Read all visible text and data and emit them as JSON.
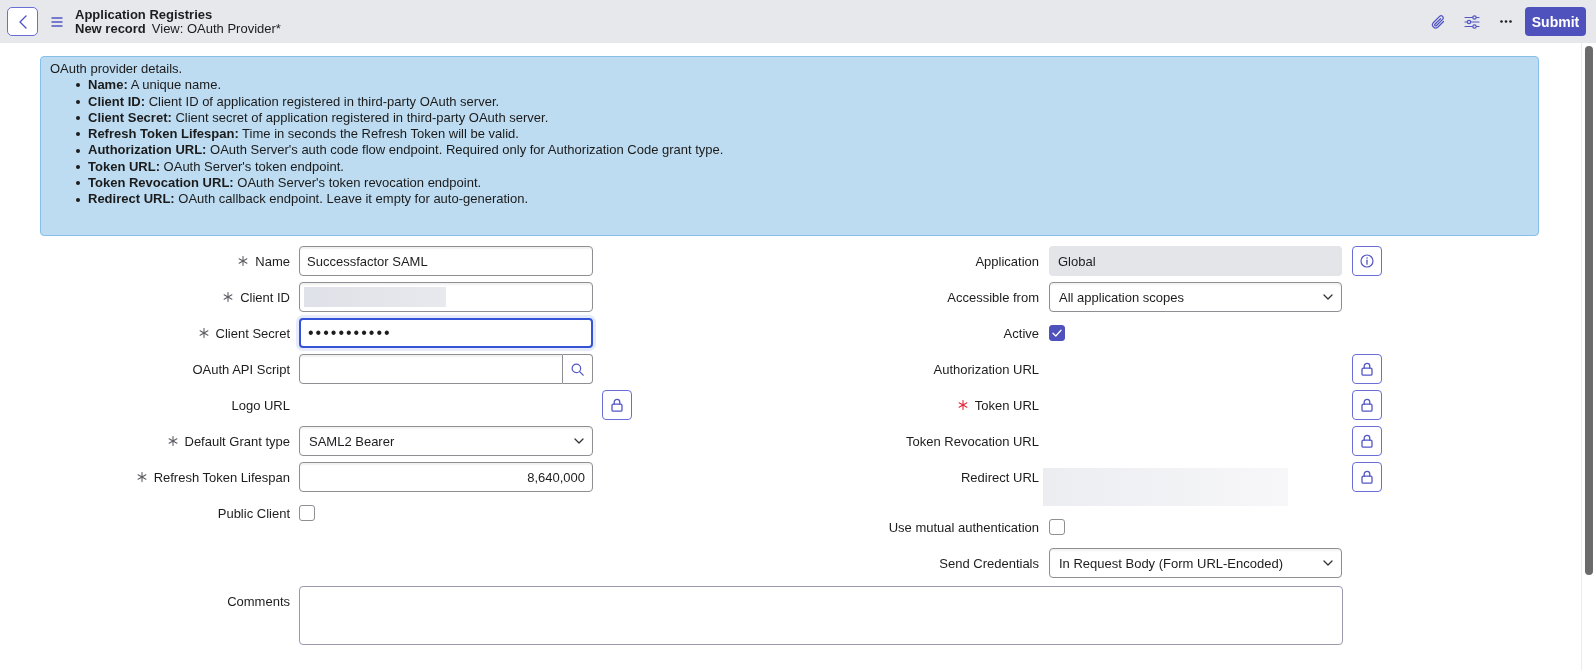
{
  "header": {
    "title": "Application Registries",
    "record_state": "New record",
    "view": "View: OAuth Provider*",
    "submit": "Submit"
  },
  "info": {
    "intro": "OAuth provider details.",
    "items": [
      "**Name:** A unique name.",
      "**Client ID:** Client ID of application registered in third-party OAuth server.",
      "**Client Secret:** Client secret of application registered in third-party OAuth server.",
      "**Refresh Token Lifespan:** Time in seconds the Refresh Token will be valid.",
      "**Authorization URL:** OAuth Server's auth code flow endpoint. Required only for Authorization Code grant type.",
      "**Token URL:** OAuth Server's token endpoint.",
      "**Token Revocation URL:** OAuth Server's token revocation endpoint.",
      "**Redirect URL:** OAuth callback endpoint. Leave it empty for auto-generation."
    ]
  },
  "form": {
    "left": [
      {
        "kind": "text",
        "label": "Name",
        "mandatory": true,
        "mandatory_met": true,
        "focused": false,
        "value": "Successfactor SAML"
      },
      {
        "kind": "text",
        "label": "Client ID",
        "mandatory": true,
        "mandatory_met": true,
        "focused": false,
        "redacted": true
      },
      {
        "kind": "password",
        "label": "Client Secret",
        "mandatory": true,
        "mandatory_met": true,
        "focused": true,
        "value": "•••••••••••"
      },
      {
        "kind": "reference",
        "label": "OAuth API Script",
        "mandatory": false,
        "focused": false
      },
      {
        "kind": "locked",
        "label": "Logo URL",
        "mandatory": false
      },
      {
        "kind": "select",
        "label": "Default Grant type",
        "mandatory": true,
        "mandatory_met": true,
        "focused": false,
        "value": "SAML2 Bearer"
      },
      {
        "kind": "number",
        "label": "Refresh Token Lifespan",
        "mandatory": true,
        "mandatory_met": true,
        "focused": false,
        "value": "8,640,000"
      },
      {
        "kind": "checkbox",
        "label": "Public Client",
        "mandatory": false,
        "checked": false
      }
    ],
    "right": [
      {
        "kind": "readonly",
        "label": "Application",
        "mandatory": false,
        "focused": false,
        "value": "Global"
      },
      {
        "kind": "select",
        "label": "Accessible from",
        "mandatory": false,
        "focused": false,
        "value": "All application scopes"
      },
      {
        "kind": "checkbox",
        "label": "Active",
        "mandatory": false,
        "checked": true
      },
      {
        "kind": "locked",
        "label": "Authorization URL",
        "mandatory": false
      },
      {
        "kind": "locked",
        "label": "Token URL",
        "mandatory": true,
        "mandatory_met": false
      },
      {
        "kind": "locked",
        "label": "Token Revocation URL",
        "mandatory": false
      },
      {
        "kind": "locked",
        "label": "Redirect URL",
        "mandatory": false,
        "redacted": true
      },
      {
        "kind": "checkbox",
        "label": "Use mutual authentication",
        "mandatory": false,
        "checked": false
      },
      {
        "kind": "select",
        "label": "Send Credentials",
        "mandatory": false,
        "focused": false,
        "value": "In Request Body (Form URL-Encoded)"
      }
    ],
    "comments": {
      "kind": "textarea",
      "label": "Comments",
      "mandatory": false,
      "focused": false
    }
  }
}
